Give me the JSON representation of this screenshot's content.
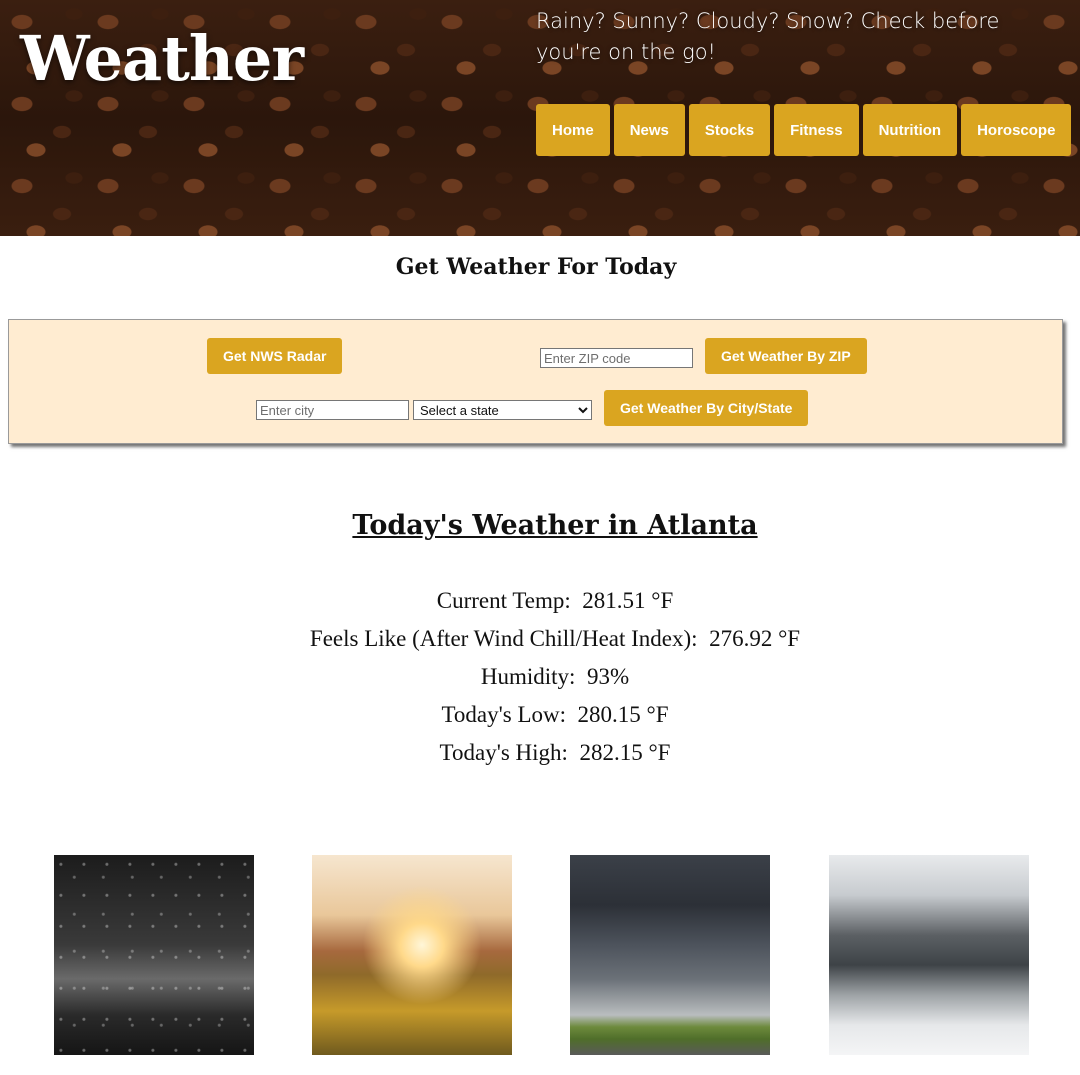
{
  "header": {
    "title": "Weather",
    "tagline": "Rainy? Sunny? Cloudy? Snow? Check before you're on the go!",
    "nav": [
      "Home",
      "News",
      "Stocks",
      "Fitness",
      "Nutrition",
      "Horoscope"
    ]
  },
  "form": {
    "title": "Get Weather For Today",
    "radar_button": "Get NWS Radar",
    "zip_placeholder": "Enter ZIP code",
    "zip_button": "Get Weather By ZIP",
    "city_placeholder": "Enter city",
    "state_selected": "Select a state",
    "city_state_button": "Get Weather By City/State"
  },
  "weather": {
    "title": "Today's Weather in Atlanta",
    "rows": [
      {
        "label": "Current Temp:",
        "value": "281.51 °F"
      },
      {
        "label": "Feels Like (After Wind Chill/Heat Index):",
        "value": "276.92 °F"
      },
      {
        "label": "Humidity:",
        "value": "93%"
      },
      {
        "label": "Today's Low:",
        "value": "280.15 °F"
      },
      {
        "label": "Today's High:",
        "value": "282.15 °F"
      }
    ]
  },
  "colors": {
    "accent": "#daa520",
    "panel": "#ffecd1"
  }
}
